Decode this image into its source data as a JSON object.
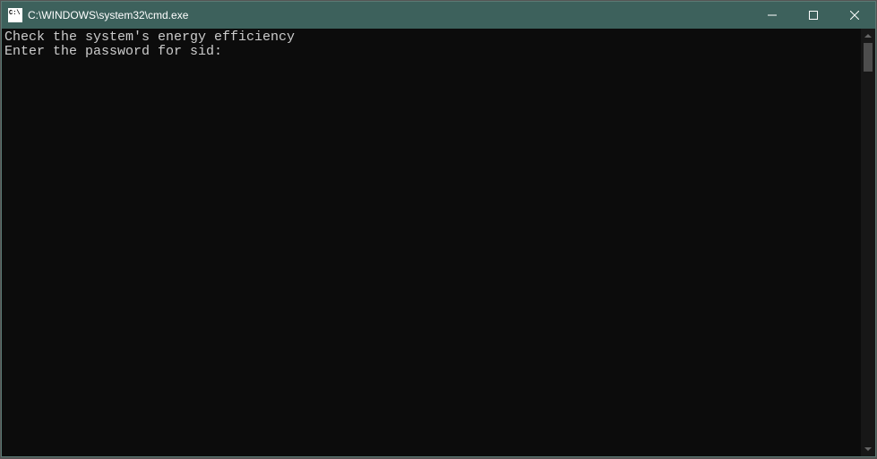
{
  "titlebar": {
    "title": "C:\\WINDOWS\\system32\\cmd.exe"
  },
  "terminal": {
    "lines": [
      "Check the system's energy efficiency",
      "Enter the password for sid:"
    ]
  }
}
